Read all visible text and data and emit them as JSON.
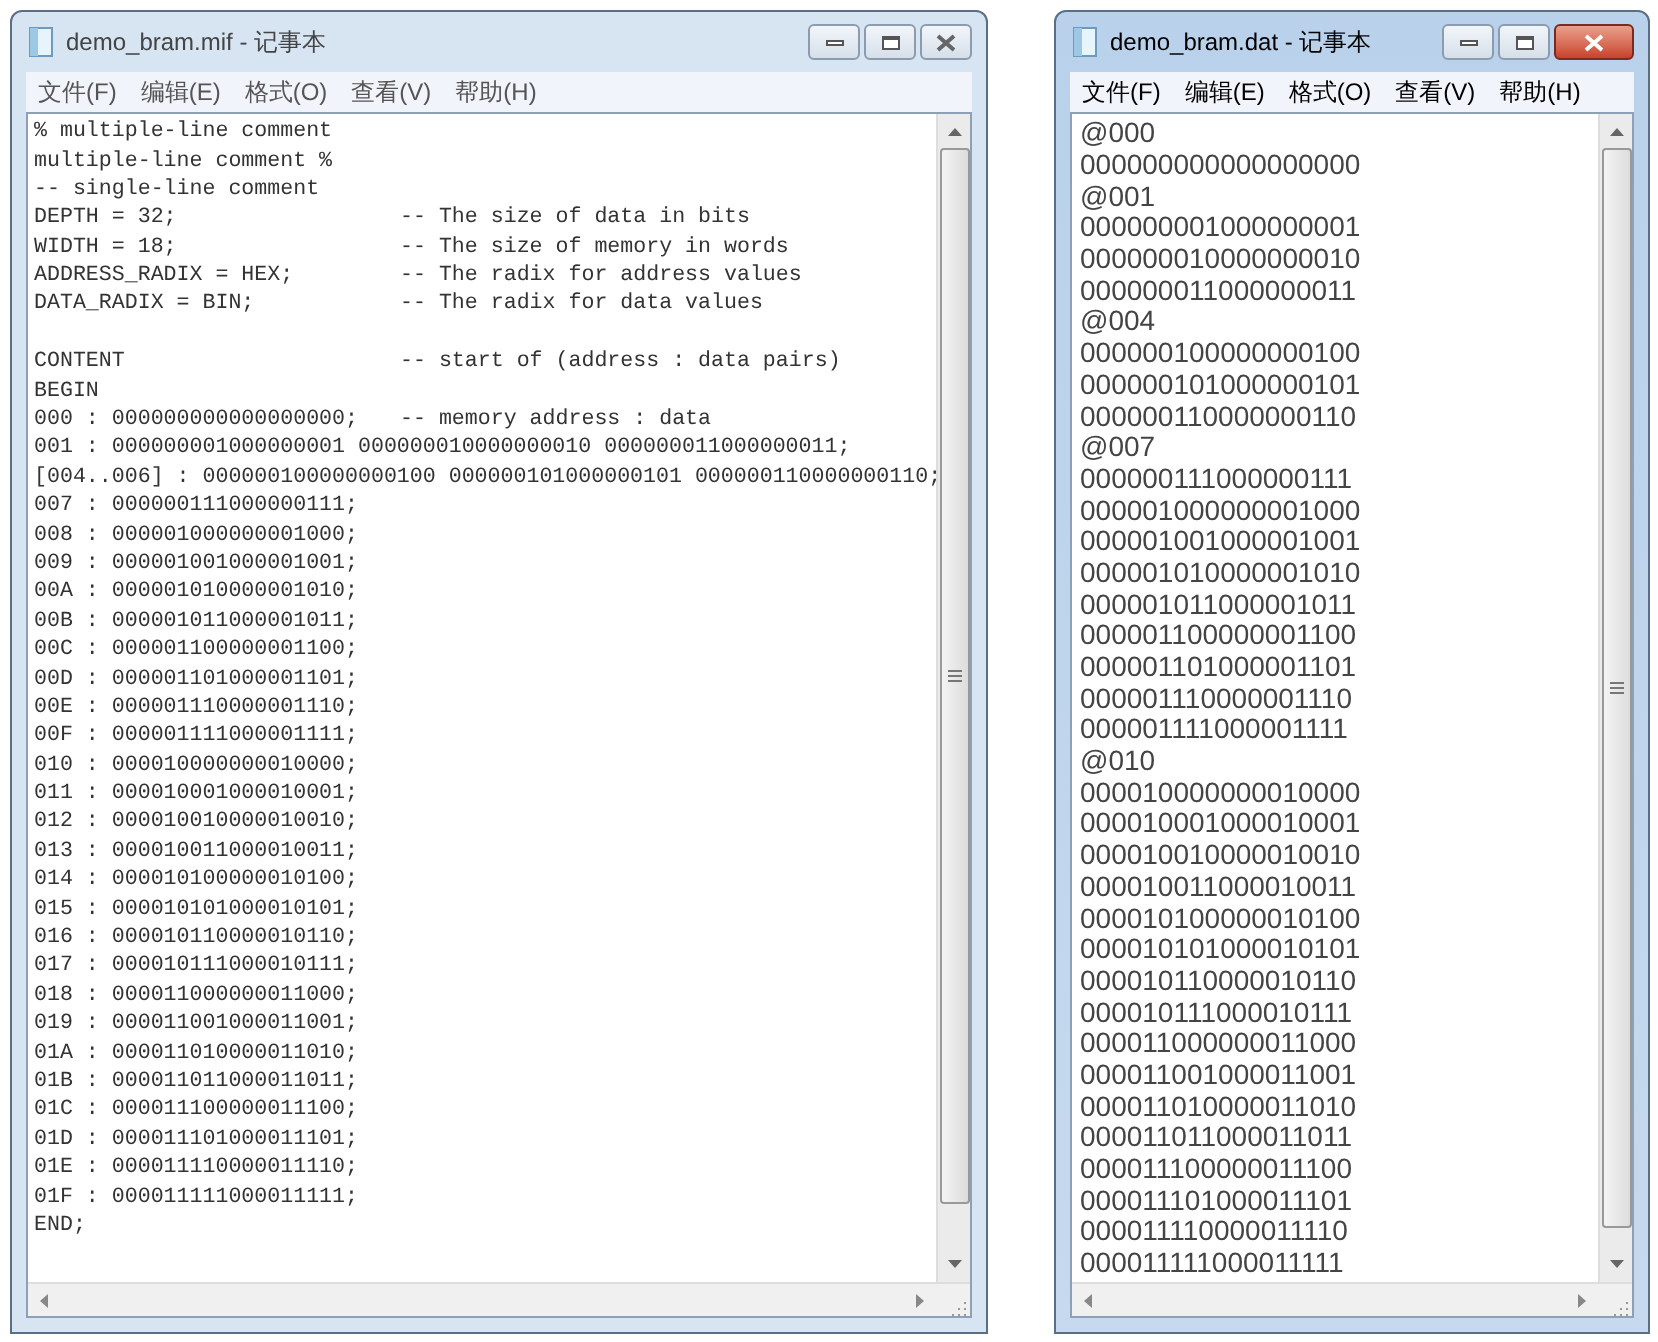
{
  "windows": [
    {
      "title": "demo_bram.mif - 记事本",
      "active": false,
      "kind": "code",
      "menu": [
        "文件(F)",
        "编辑(E)",
        "格式(O)",
        "查看(V)",
        "帮助(H)"
      ],
      "lines": [
        {
          "kind": "text",
          "code": "% multiple-line comment"
        },
        {
          "kind": "text",
          "code": "multiple-line comment %"
        },
        {
          "kind": "text",
          "code": "-- single-line comment"
        },
        {
          "kind": "text",
          "code": "DEPTH = 32;",
          "comment": "-- The size of data in bits"
        },
        {
          "kind": "text",
          "code": "WIDTH = 18;",
          "comment": "-- The size of memory in words"
        },
        {
          "kind": "text",
          "code": "ADDRESS_RADIX = HEX;",
          "comment": "-- The radix for address values"
        },
        {
          "kind": "text",
          "code": "DATA_RADIX = BIN;",
          "comment": "-- The radix for data values"
        },
        {
          "kind": "blank"
        },
        {
          "kind": "text",
          "code": "CONTENT",
          "comment": "-- start of (address : data pairs)"
        },
        {
          "kind": "text",
          "code": "BEGIN"
        },
        {
          "kind": "text",
          "code": "000 : 000000000000000000;",
          "comment": "-- memory address : data"
        },
        {
          "kind": "text",
          "code": "001 : 000000001000000001 000000010000000010 000000011000000011;"
        },
        {
          "kind": "text",
          "code": "[004..006] : 000000100000000100 000000101000000101 000000110000000110;"
        },
        {
          "kind": "text",
          "code": "007 : 000000111000000111;"
        },
        {
          "kind": "text",
          "code": "008 : 000001000000001000;"
        },
        {
          "kind": "text",
          "code": "009 : 000001001000001001;"
        },
        {
          "kind": "text",
          "code": "00A : 000001010000001010;"
        },
        {
          "kind": "text",
          "code": "00B : 000001011000001011;"
        },
        {
          "kind": "text",
          "code": "00C : 000001100000001100;"
        },
        {
          "kind": "text",
          "code": "00D : 000001101000001101;"
        },
        {
          "kind": "text",
          "code": "00E : 000001110000001110;"
        },
        {
          "kind": "text",
          "code": "00F : 000001111000001111;"
        },
        {
          "kind": "text",
          "code": "010 : 000010000000010000;"
        },
        {
          "kind": "text",
          "code": "011 : 000010001000010001;"
        },
        {
          "kind": "text",
          "code": "012 : 000010010000010010;"
        },
        {
          "kind": "text",
          "code": "013 : 000010011000010011;"
        },
        {
          "kind": "text",
          "code": "014 : 000010100000010100;"
        },
        {
          "kind": "text",
          "code": "015 : 000010101000010101;"
        },
        {
          "kind": "text",
          "code": "016 : 000010110000010110;"
        },
        {
          "kind": "text",
          "code": "017 : 000010111000010111;"
        },
        {
          "kind": "text",
          "code": "018 : 000011000000011000;"
        },
        {
          "kind": "text",
          "code": "019 : 000011001000011001;"
        },
        {
          "kind": "text",
          "code": "01A : 000011010000011010;"
        },
        {
          "kind": "text",
          "code": "01B : 000011011000011011;"
        },
        {
          "kind": "text",
          "code": "01C : 000011100000011100;"
        },
        {
          "kind": "text",
          "code": "01D : 000011101000011101;"
        },
        {
          "kind": "text",
          "code": "01E : 000011110000011110;"
        },
        {
          "kind": "text",
          "code": "01F : 000011111000011111;"
        },
        {
          "kind": "text",
          "code": "END;"
        }
      ]
    },
    {
      "title": "demo_bram.dat - 记事本",
      "active": true,
      "kind": "data",
      "menu": [
        "文件(F)",
        "编辑(E)",
        "格式(O)",
        "查看(V)",
        "帮助(H)"
      ],
      "lines": [
        {
          "kind": "text",
          "code": "@000"
        },
        {
          "kind": "text",
          "code": "000000000000000000"
        },
        {
          "kind": "text",
          "code": "@001"
        },
        {
          "kind": "text",
          "code": "000000001000000001"
        },
        {
          "kind": "text",
          "code": "000000010000000010"
        },
        {
          "kind": "text",
          "code": "000000011000000011"
        },
        {
          "kind": "text",
          "code": "@004"
        },
        {
          "kind": "text",
          "code": "000000100000000100"
        },
        {
          "kind": "text",
          "code": "000000101000000101"
        },
        {
          "kind": "text",
          "code": "000000110000000110"
        },
        {
          "kind": "text",
          "code": "@007"
        },
        {
          "kind": "text",
          "code": "000000111000000111"
        },
        {
          "kind": "text",
          "code": "000001000000001000"
        },
        {
          "kind": "text",
          "code": "000001001000001001"
        },
        {
          "kind": "text",
          "code": "000001010000001010"
        },
        {
          "kind": "text",
          "code": "000001011000001011"
        },
        {
          "kind": "text",
          "code": "000001100000001100"
        },
        {
          "kind": "text",
          "code": "000001101000001101"
        },
        {
          "kind": "text",
          "code": "000001110000001110"
        },
        {
          "kind": "text",
          "code": "000001111000001111"
        },
        {
          "kind": "text",
          "code": "@010"
        },
        {
          "kind": "text",
          "code": "000010000000010000"
        },
        {
          "kind": "text",
          "code": "000010001000010001"
        },
        {
          "kind": "text",
          "code": "000010010000010010"
        },
        {
          "kind": "text",
          "code": "000010011000010011"
        },
        {
          "kind": "text",
          "code": "000010100000010100"
        },
        {
          "kind": "text",
          "code": "000010101000010101"
        },
        {
          "kind": "text",
          "code": "000010110000010110"
        },
        {
          "kind": "text",
          "code": "000010111000010111"
        },
        {
          "kind": "text",
          "code": "000011000000011000"
        },
        {
          "kind": "text",
          "code": "000011001000011001"
        },
        {
          "kind": "text",
          "code": "000011010000011010"
        },
        {
          "kind": "text",
          "code": "000011011000011011"
        },
        {
          "kind": "text",
          "code": "000011100000011100"
        },
        {
          "kind": "text",
          "code": "000011101000011101"
        },
        {
          "kind": "text",
          "code": "000011110000011110"
        },
        {
          "kind": "text",
          "code": "000011111000011111"
        }
      ]
    }
  ]
}
